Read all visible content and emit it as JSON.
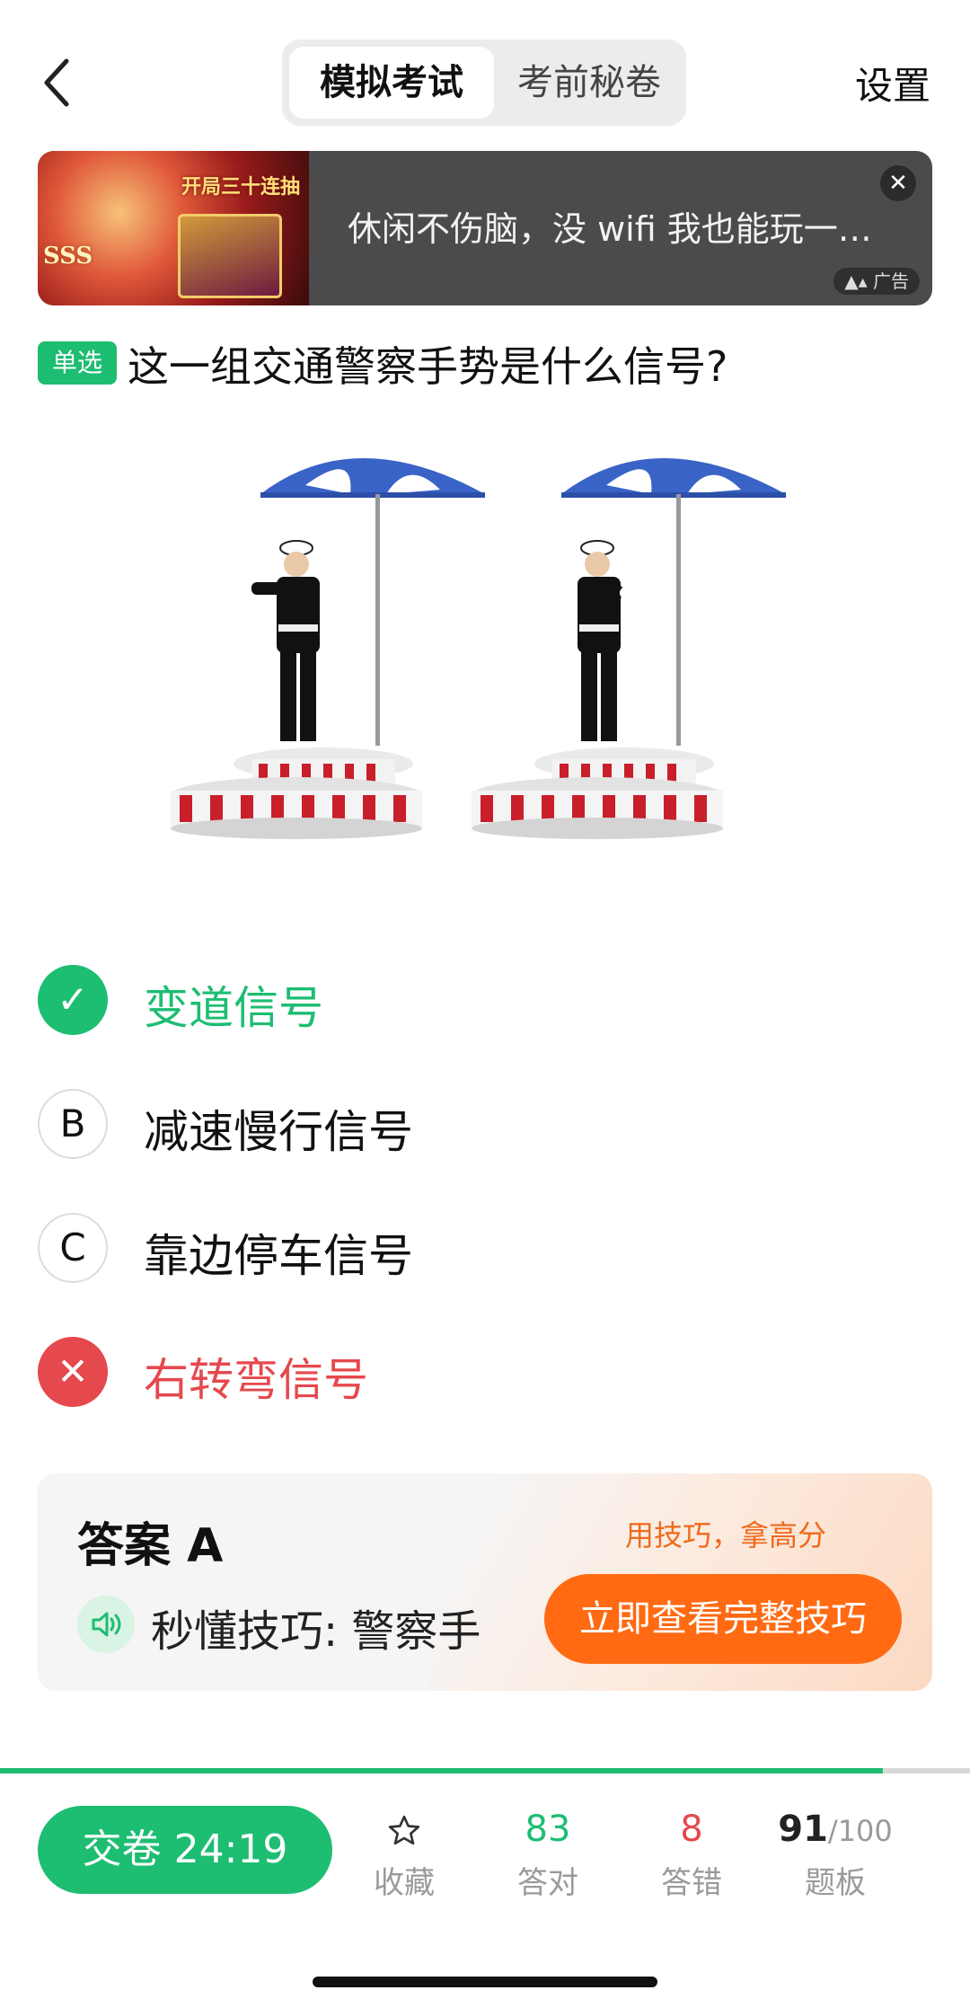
{
  "header": {
    "tabs": [
      {
        "label": "模拟考试",
        "active": true
      },
      {
        "label": "考前秘卷",
        "active": false
      }
    ],
    "settings_label": "设置"
  },
  "ad": {
    "text": "休闲不伤脑，没 wifi 我也能玩一…",
    "badge": "广告",
    "image_title": "开局三十连抽",
    "image_rank": "SSS"
  },
  "question": {
    "type_tag": "单选",
    "text": "这一组交通警察手势是什么信号?"
  },
  "options": [
    {
      "mark": "✓",
      "label": "变道信号",
      "state": "correct"
    },
    {
      "mark": "B",
      "label": "减速慢行信号",
      "state": "normal"
    },
    {
      "mark": "C",
      "label": "靠边停车信号",
      "state": "normal"
    },
    {
      "mark": "✕",
      "label": "右转弯信号",
      "state": "wrong"
    }
  ],
  "answer": {
    "title": "答案 A",
    "promo": "用技巧，拿高分",
    "tip": "秒懂技巧: 警察手",
    "cta": "立即查看完整技巧"
  },
  "progress": {
    "fraction": 0.91
  },
  "bottom": {
    "submit_label": "交卷 24:19",
    "favorite_label": "收藏",
    "correct_count": "83",
    "correct_label": "答对",
    "wrong_count": "8",
    "wrong_label": "答错",
    "board_current": "91",
    "board_total": "/100",
    "board_label": "题板"
  },
  "colors": {
    "accent_green": "#1dbd72",
    "error_red": "#e5484d",
    "cta_orange": "#ff6a13"
  }
}
